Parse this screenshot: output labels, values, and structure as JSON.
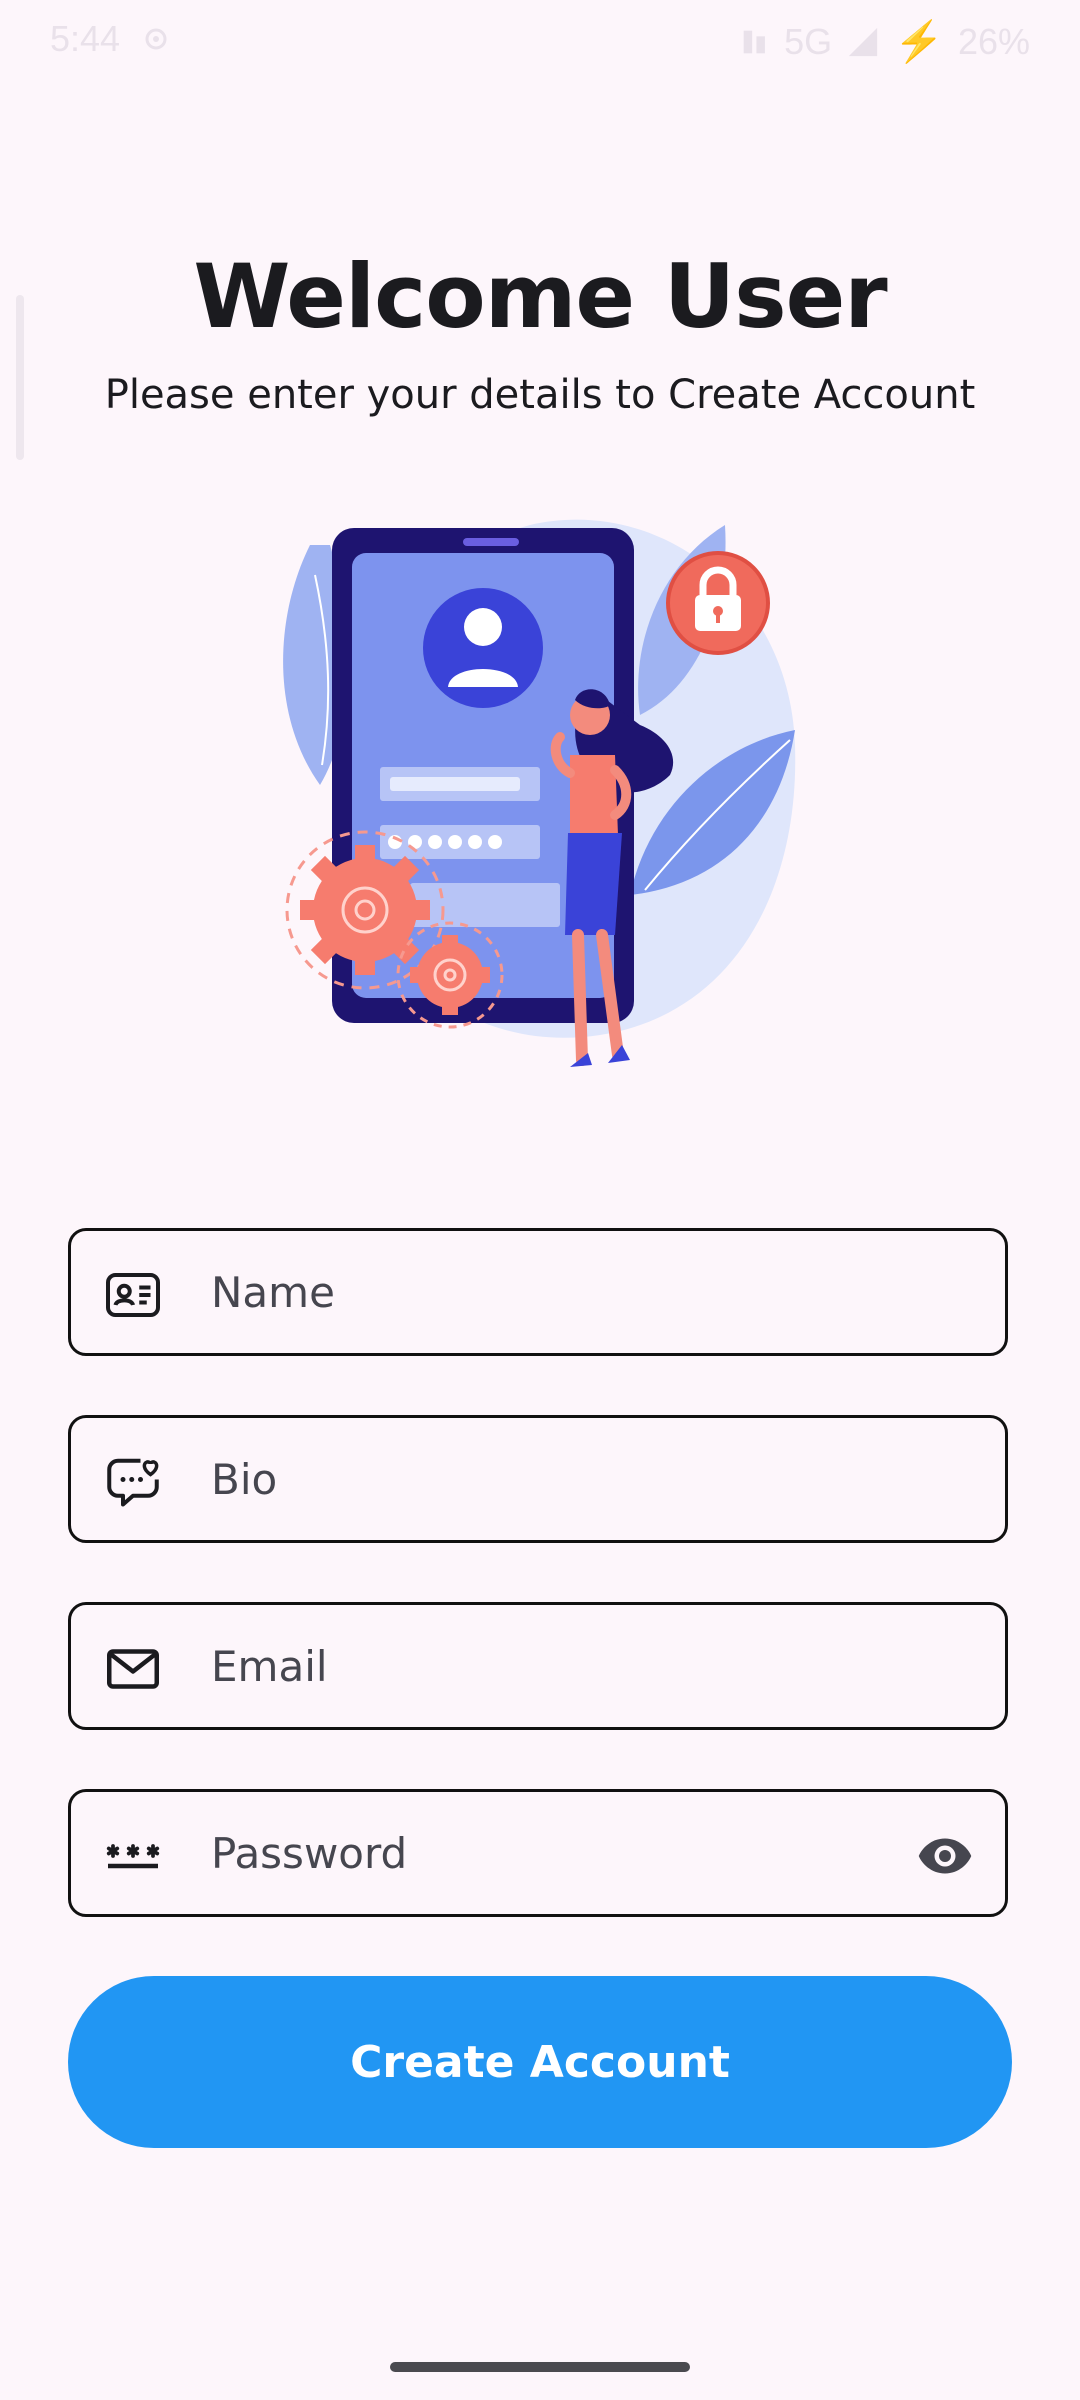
{
  "status_bar": {
    "time": "5:44",
    "network": "5G",
    "battery": "26%"
  },
  "header": {
    "title": "Welcome User",
    "subtitle": "Please enter your details to Create Account"
  },
  "form": {
    "name": {
      "placeholder": "Name",
      "value": "",
      "icon": "contact-card-icon"
    },
    "bio": {
      "placeholder": "Bio",
      "value": "",
      "icon": "chat-heart-icon"
    },
    "email": {
      "placeholder": "Email",
      "value": "",
      "icon": "mail-icon"
    },
    "password": {
      "placeholder": "Password",
      "value": "",
      "icon": "password-icon",
      "toggle_icon": "eye-icon"
    }
  },
  "actions": {
    "create_account_label": "Create Account"
  },
  "colors": {
    "background": "#fdf6fb",
    "primary": "#2196f3",
    "illustration_purple": "#1e1470",
    "illustration_accent": "#f67c6e"
  }
}
